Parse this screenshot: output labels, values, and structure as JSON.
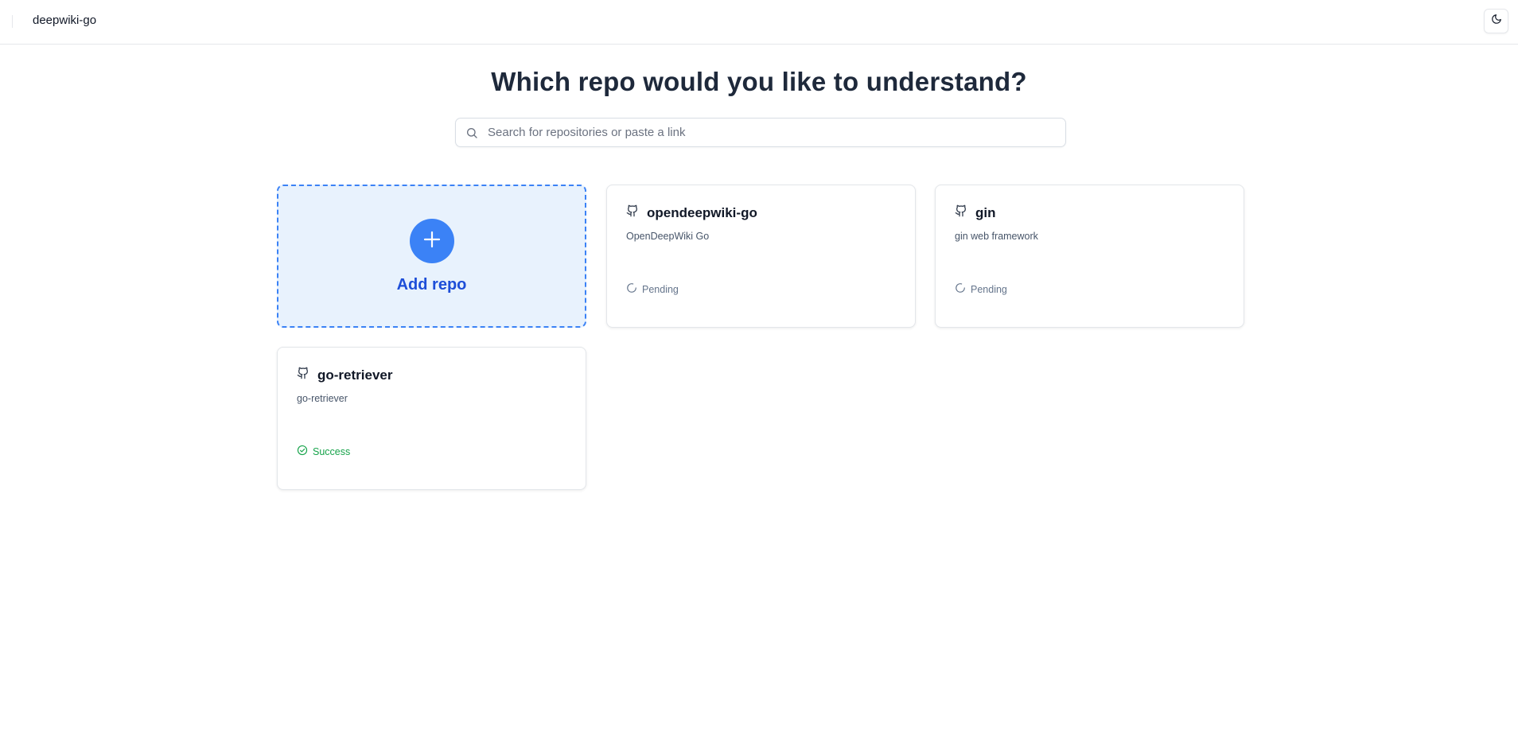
{
  "header": {
    "app_title": "deepwiki-go",
    "theme_toggle_icon": "moon-icon"
  },
  "main": {
    "heading": "Which repo would you like to understand?",
    "search": {
      "placeholder": "Search for repositories or paste a link",
      "value": ""
    },
    "add_repo": {
      "label": "Add repo",
      "icon": "plus-icon"
    },
    "repos": [
      {
        "name": "opendeepwiki-go",
        "description": "OpenDeepWiki Go",
        "status": "Pending",
        "status_icon": "spinner-icon"
      },
      {
        "name": "gin",
        "description": "gin web framework",
        "status": "Pending",
        "status_icon": "spinner-icon"
      },
      {
        "name": "go-retriever",
        "description": "go-retriever",
        "status": "Success",
        "status_icon": "check-circle-icon"
      }
    ]
  },
  "colors": {
    "accent": "#3b82f6",
    "accent_dark": "#1d4ed8",
    "add_card_bg": "#e8f2fd",
    "success": "#16a34a",
    "pending": "#64748b"
  }
}
